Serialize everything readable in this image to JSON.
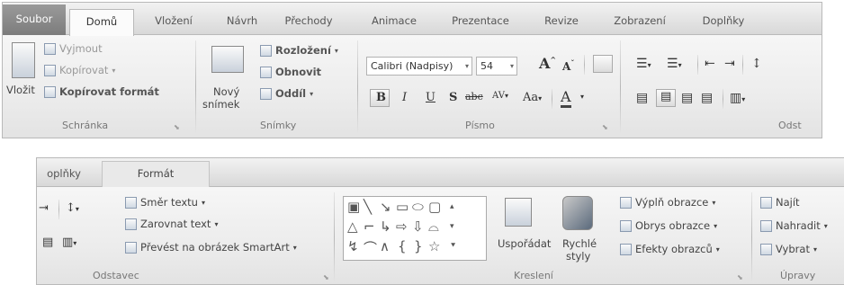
{
  "top": {
    "tabs": [
      "Soubor",
      "Domů",
      "Vložení",
      "Návrh",
      "Přechody",
      "Animace",
      "Prezentace",
      "Revize",
      "Zobrazení",
      "Doplňky"
    ],
    "clipboard": {
      "paste": "Vložit",
      "cut": "Vyjmout",
      "copy": "Kopírovat",
      "format_painter": "Kopírovat formát",
      "label": "Schránka"
    },
    "slides": {
      "new_slide_line1": "Nový",
      "new_slide_line2": "snímek",
      "layout": "Rozložení",
      "reset": "Obnovit",
      "section": "Oddíl",
      "label": "Snímky"
    },
    "font": {
      "name": "Calibri (Nadpisy)",
      "size": "54",
      "bold": "B",
      "italic": "I",
      "underline": "U",
      "shadow": "S",
      "strike": "abc",
      "spacing": "AV",
      "case": "Aa",
      "color_a": "A",
      "label": "Písmo"
    },
    "paragraph_label": "Odst"
  },
  "bottom": {
    "tabs": [
      "oplňky",
      "Formát"
    ],
    "text_direction": "Směr textu",
    "align_text": "Zarovnat text",
    "smartart": "Převést na obrázek SmartArt",
    "paragraph_label": "Odstavec",
    "arrange": "Uspořádat",
    "quick_styles_line1": "Rychlé",
    "quick_styles_line2": "styly",
    "drawing_label": "Kreslení",
    "shape_fill": "Výplň obrazce",
    "shape_outline": "Obrys obrazce",
    "shape_effects": "Efekty obrazců",
    "find": "Najít",
    "replace": "Nahradit",
    "select": "Vybrat",
    "editing_label": "Úpravy"
  }
}
